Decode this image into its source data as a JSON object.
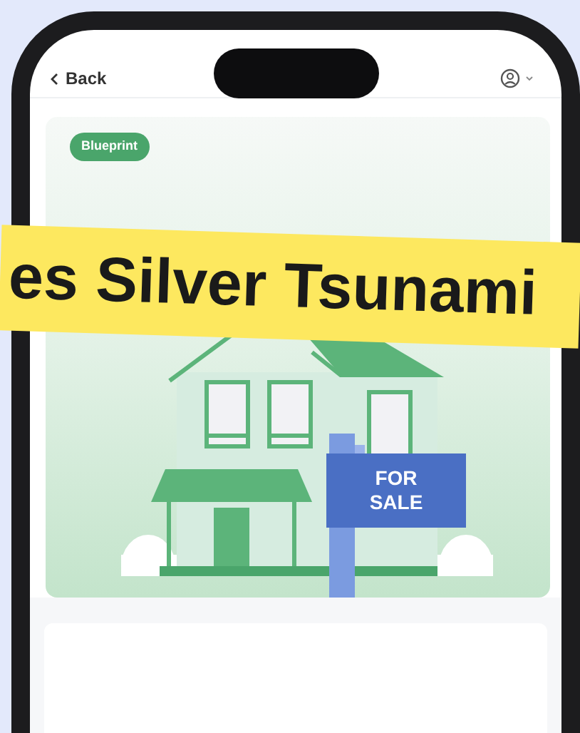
{
  "header": {
    "back_label": "Back"
  },
  "card": {
    "badge": "Blueprint",
    "sign": "FOR SALE"
  },
  "banner": {
    "text": "es Silver Tsunami"
  }
}
